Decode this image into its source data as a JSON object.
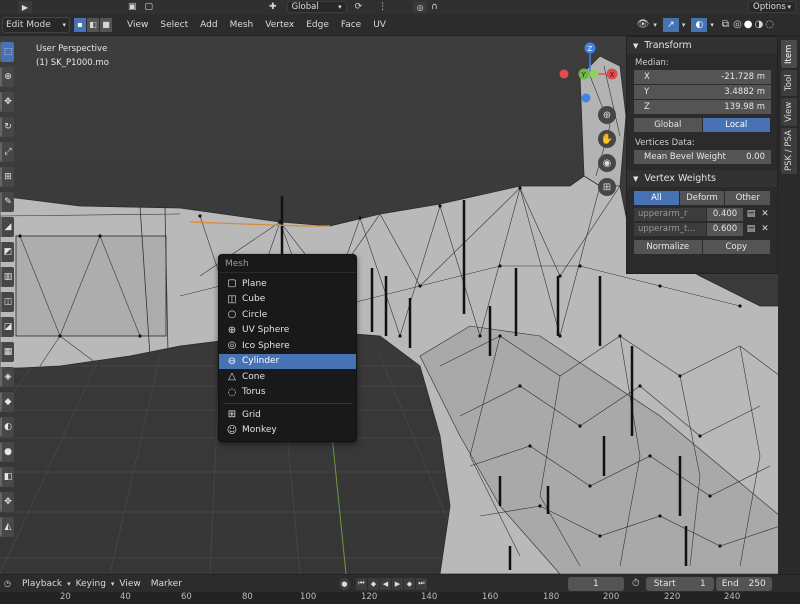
{
  "topbar": {
    "orientation": "Global",
    "options_label": "Options"
  },
  "header": {
    "mode": "Edit Mode",
    "menus": [
      "View",
      "Select",
      "Add",
      "Mesh",
      "Vertex",
      "Edge",
      "Face",
      "UV"
    ]
  },
  "viewport": {
    "perspective": "User Perspective",
    "object_name": "(1) SK_P1000.mo"
  },
  "gizmo": {
    "z_label": "Z",
    "y_label": "Y",
    "x_label": "X"
  },
  "transform": {
    "title": "Transform",
    "median_label": "Median:",
    "x_label": "X",
    "x_value": "-21.728 m",
    "y_label": "Y",
    "y_value": "3.4882 m",
    "z_label": "Z",
    "z_value": "139.98 m",
    "global_label": "Global",
    "local_label": "Local",
    "vertices_data_label": "Vertices Data:",
    "bevel_label": "Mean Bevel Weight",
    "bevel_value": "0.00"
  },
  "vertex_weights": {
    "title": "Vertex Weights",
    "filters": [
      "All",
      "Deform",
      "Other"
    ],
    "rows": [
      {
        "name": "upperarm_r",
        "value": "0.400"
      },
      {
        "name": "upperarm_t...",
        "value": "0.600"
      }
    ],
    "normalize_label": "Normalize",
    "copy_label": "Copy"
  },
  "side_tabs": [
    "Item",
    "Tool",
    "View",
    "PSK / PSA"
  ],
  "mesh_menu": {
    "title": "Mesh",
    "items": [
      "Plane",
      "Cube",
      "Circle",
      "UV Sphere",
      "Ico Sphere",
      "Cylinder",
      "Cone",
      "Torus"
    ],
    "extra_items": [
      "Grid",
      "Monkey"
    ],
    "highlighted": "Cylinder"
  },
  "timeline": {
    "playback_label": "Playback",
    "keying_label": "Keying",
    "view_label": "View",
    "marker_label": "Marker",
    "current_frame": "1",
    "start_label": "Start",
    "start_value": "1",
    "end_label": "End",
    "end_value": "250"
  },
  "ruler_ticks": [
    "20",
    "40",
    "60",
    "80",
    "100",
    "120",
    "140",
    "160",
    "180",
    "200",
    "220",
    "240"
  ],
  "colors": {
    "accent": "#4772b3",
    "viewport_bg": "#3a3a3a",
    "mesh_fill": "#b8b8b8",
    "gizmo_x": "#e24b4b",
    "gizmo_y": "#6fb64c",
    "gizmo_z": "#3f82e6"
  }
}
